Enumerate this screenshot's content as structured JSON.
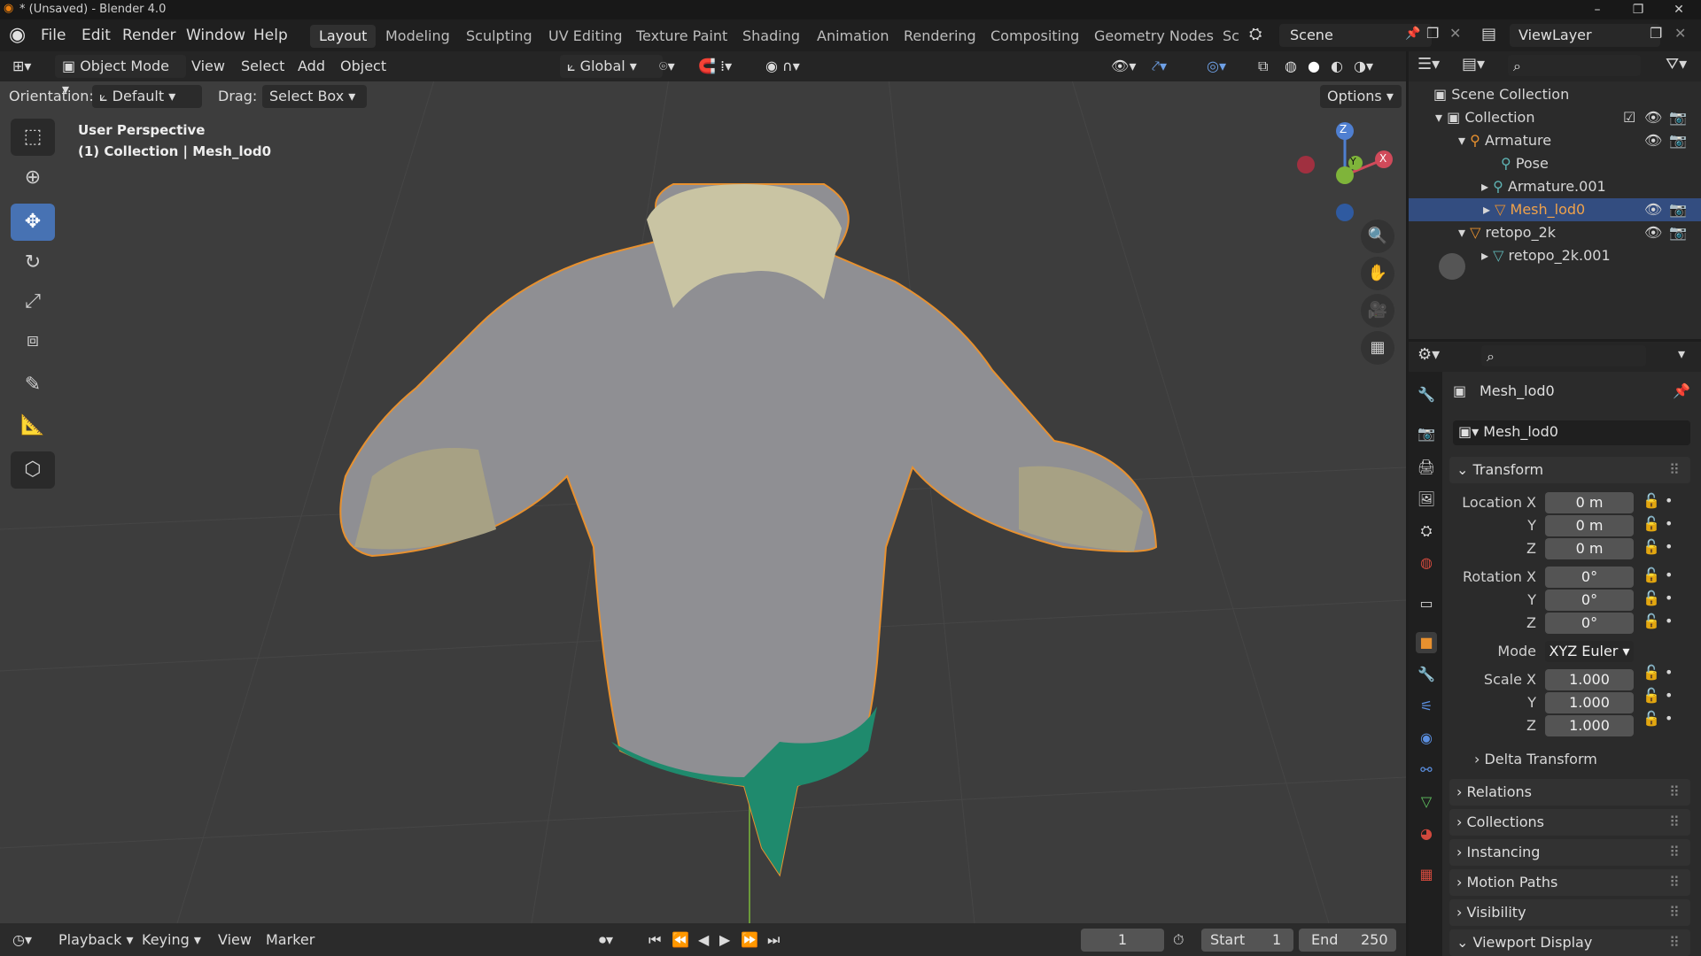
{
  "title_bar": {
    "title": "* (Unsaved) - Blender 4.0",
    "minimize": "–",
    "maximize": "❐",
    "close": "✕"
  },
  "menu": {
    "items": [
      "File",
      "Edit",
      "Render",
      "Window",
      "Help"
    ]
  },
  "workspaces": {
    "tabs": [
      "Layout",
      "Modeling",
      "Sculpting",
      "UV Editing",
      "Texture Paint",
      "Shading",
      "Animation",
      "Rendering",
      "Compositing",
      "Geometry Nodes",
      "Sc"
    ],
    "active": "Layout"
  },
  "scene": {
    "label": "Scene",
    "view_layer": "ViewLayer"
  },
  "viewport_header": {
    "mode": "Object Mode",
    "menus": [
      "View",
      "Select",
      "Add",
      "Object"
    ],
    "transform_orientation": "Global",
    "orientation_label": "Orientation:",
    "orientation_value": "Default",
    "drag_label": "Drag:",
    "drag_value": "Select Box",
    "options": "Options"
  },
  "viewport_overlay": {
    "perspective": "User Perspective",
    "context": "(1) Collection | Mesh_lod0"
  },
  "gizmo": {
    "z": "Z",
    "y": "Y",
    "x": "X"
  },
  "outliner": {
    "rows": [
      {
        "label": "Scene Collection",
        "indent": 0,
        "expander": ""
      },
      {
        "label": "Collection",
        "indent": 1,
        "expander": "▾"
      },
      {
        "label": "Armature",
        "indent": 2,
        "expander": "▾"
      },
      {
        "label": "Pose",
        "indent": 3,
        "expander": ""
      },
      {
        "label": "Armature.001",
        "indent": 3,
        "expander": "▸"
      },
      {
        "label": "Mesh_lod0",
        "indent": 3,
        "expander": "▸"
      },
      {
        "label": "retopo_2k",
        "indent": 2,
        "expander": "▾"
      },
      {
        "label": "retopo_2k.001",
        "indent": 3,
        "expander": "▸"
      }
    ],
    "selected": "Mesh_lod0"
  },
  "properties": {
    "object_name": "Mesh_lod0",
    "object_field": "Mesh_lod0",
    "transform_title": "Transform",
    "location": {
      "label_x": "Location X",
      "label_y": "Y",
      "label_z": "Z",
      "x": "0 m",
      "y": "0 m",
      "z": "0 m"
    },
    "rotation": {
      "label_x": "Rotation X",
      "label_y": "Y",
      "label_z": "Z",
      "x": "0°",
      "y": "0°",
      "z": "0°"
    },
    "mode_label": "Mode",
    "mode_value": "XYZ Euler",
    "scale": {
      "label_x": "Scale X",
      "label_y": "Y",
      "label_z": "Z",
      "x": "1.000",
      "y": "1.000",
      "z": "1.000"
    },
    "delta_transform": "Delta Transform",
    "panels": [
      "Relations",
      "Collections",
      "Instancing",
      "Motion Paths",
      "Visibility",
      "Viewport Display"
    ]
  },
  "timeline": {
    "menus": [
      "Playback",
      "Keying",
      "View",
      "Marker"
    ],
    "current_frame": "1",
    "start_label": "Start",
    "start": "1",
    "end_label": "End",
    "end": "250"
  },
  "colors": {
    "accent": "#4772b3",
    "selection_outline": "#e8912f",
    "viewport_bg": "#3d3d3d",
    "panel_bg": "#2b2b2b"
  }
}
